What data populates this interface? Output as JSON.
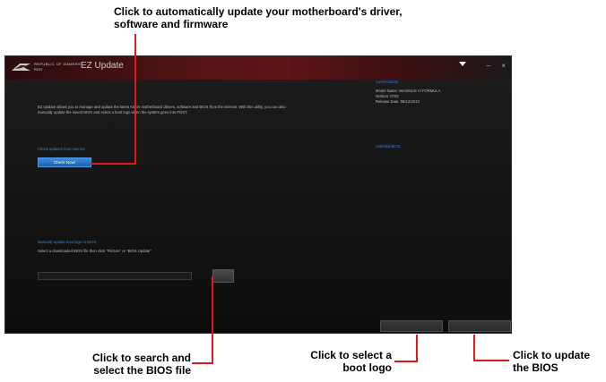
{
  "callouts": {
    "top": "Click to automatically update your motherboard's driver, software and firmware",
    "search": "Click to search and select the BIOS file",
    "boot_logo": "Click to select a boot logo",
    "update_bios": "Click to update the BIOS"
  },
  "window": {
    "brand_line1": "REPUBLIC OF GAMERS",
    "brand_line2": "ROG",
    "title": "EZ Update",
    "controls": [
      "–",
      "×"
    ]
  },
  "main": {
    "intro": "EZ Update allows you to manage and update the latest ASUS motherboard drivers, software and BIOS from the internet. With this utility, you can also manually update the saved BIOS and select a boot logo when the system goes into POST.",
    "check_label": "Check updates from internet",
    "check_now": "Check Now!",
    "manual_title": "Manually update boot logo or BIOS :",
    "manual_desc": "Select a downloaded BIOS file then click \"Flicture\" or \"BIOS Update\"",
    "bios_path": ""
  },
  "sidebar": {
    "current_title": "Current BIOS",
    "model": "Model Name: MAXIMUS VI FORMULA",
    "version": "Version: 0703",
    "release": "Release Date: 08/12/2013",
    "selected_title": "Selected BIOS"
  },
  "colors": {
    "accent_red": "#e0191e",
    "link_blue": "#3a86d4",
    "button_blue": "#2c7ad0"
  },
  "icons": {
    "rog_logo": "rog-eye-icon",
    "dropdown": "dropdown-triangle-icon"
  }
}
